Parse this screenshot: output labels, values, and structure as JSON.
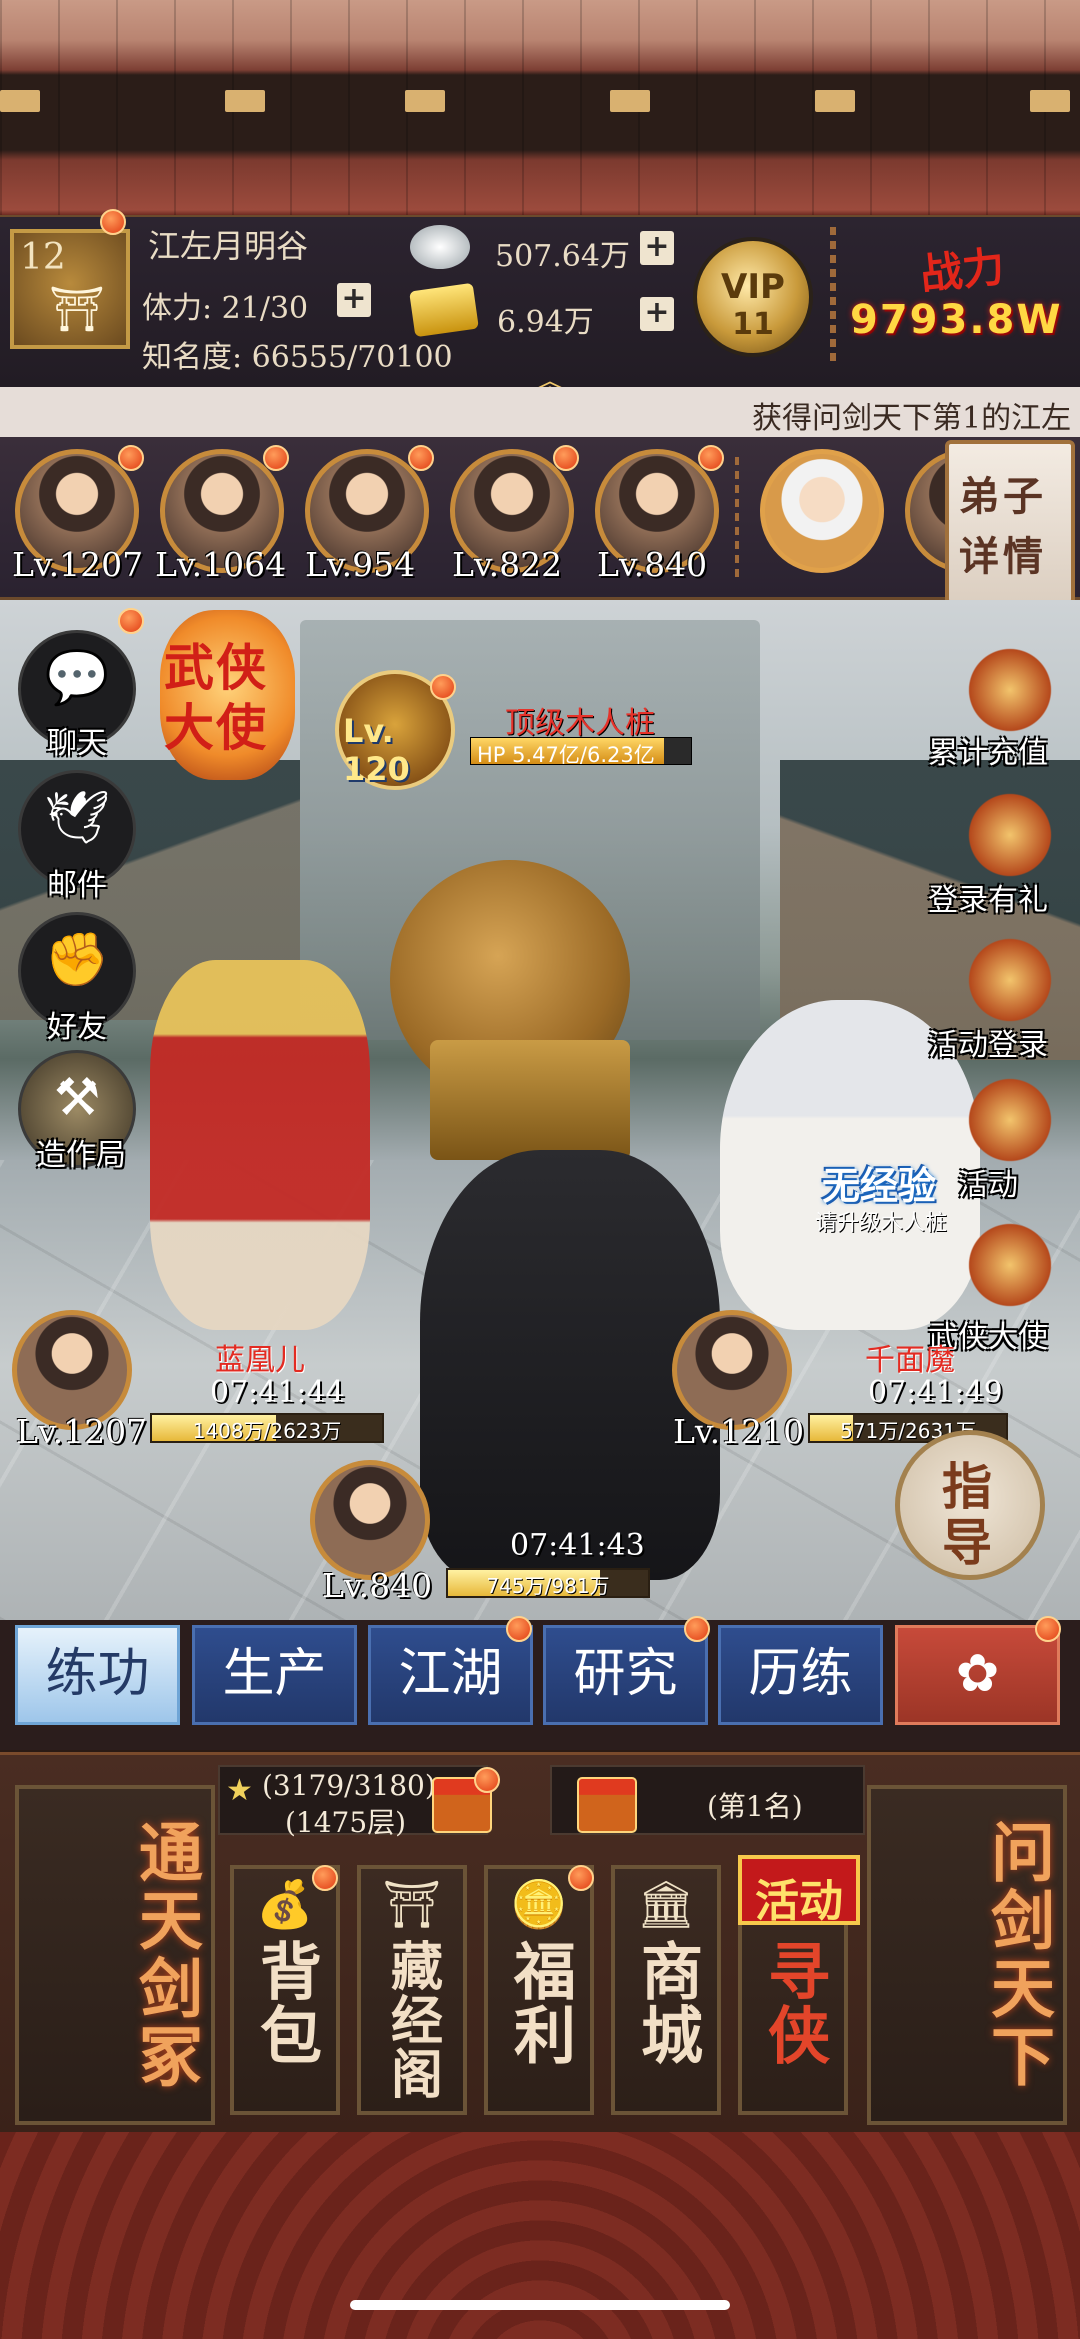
{
  "header": {
    "player_level": "12",
    "player_name": "江左月明谷",
    "stamina_label": "体力:",
    "stamina_value": "21/30",
    "fame_label": "知名度:",
    "fame_value": "66555/70100",
    "silver": "507.64万",
    "gold": "6.94万",
    "vip_label": "VIP",
    "vip_level": "11",
    "power_label": "战力",
    "power_value": "9793.8W",
    "plus_label": "+",
    "expand_icon": "double-chevron-up-icon"
  },
  "marquee": {
    "text": "获得问剑天下第1的江左"
  },
  "disciples": [
    {
      "level": "Lv.1207"
    },
    {
      "level": "Lv.1064"
    },
    {
      "level": "Lv.954"
    },
    {
      "level": "Lv.822"
    },
    {
      "level": "Lv.840"
    },
    {
      "level": ""
    },
    {
      "level": ""
    }
  ],
  "disciple_detail": {
    "line1": "弟子",
    "line2": "详情"
  },
  "left_menu": [
    {
      "label": "聊天",
      "icon": "chat-bubble-icon",
      "glyph": "💬"
    },
    {
      "label": "邮件",
      "icon": "dove-mail-icon",
      "glyph": "🕊"
    },
    {
      "label": "好友",
      "icon": "fist-friend-icon",
      "glyph": "✊"
    },
    {
      "label": "造作局",
      "icon": "workshop-icon",
      "glyph": "⚒"
    }
  ],
  "lantern": {
    "line1": "武侠",
    "line2": "大使"
  },
  "boss": {
    "badge": "Lv. 120",
    "name": "顶级木人桩",
    "hp_text": "HP 5.47亿/6.23亿",
    "hp_fraction": 0.878
  },
  "right_menu": [
    {
      "label": "累计充值",
      "icon": "treasure-icon"
    },
    {
      "label": "登录有礼",
      "icon": "chest-icon"
    },
    {
      "label": "活动登录",
      "icon": "lantern-icon"
    },
    {
      "label": "活动",
      "icon": "festival-icon"
    },
    {
      "label": "武侠大使",
      "icon": "warrior-icon"
    }
  ],
  "no_exp": {
    "title": "无经验",
    "tip": "请升级木人桩"
  },
  "units": {
    "left": {
      "name": "蓝凰儿",
      "timer": "07:41:44",
      "level": "Lv.1207",
      "hp_text": "1408万/2623万",
      "hp_fraction": 0.537
    },
    "right": {
      "name": "千面魔",
      "timer": "07:41:49",
      "level": "Lv.1210",
      "hp_text": "571万/2631万",
      "hp_fraction": 0.217
    },
    "center": {
      "timer": "07:41:43",
      "level": "Lv.840",
      "hp_text": "745万/981万",
      "hp_fraction": 0.759
    }
  },
  "guide": {
    "line1": "指",
    "line2": "导"
  },
  "tabs": [
    {
      "label": "练功"
    },
    {
      "label": "生产"
    },
    {
      "label": "江湖"
    },
    {
      "label": "研究"
    },
    {
      "label": "历练"
    },
    {
      "label": "",
      "icon": "flower-icon"
    }
  ],
  "bottom": {
    "left_card": "通天剑冢",
    "right_card": "问剑天下",
    "tower_progress": "(3179/3180)",
    "tower_floor": "(1475层)",
    "rank_text": "(第1名)",
    "hot_tag": "活动",
    "cards": [
      {
        "label": "背包",
        "icon": "bag-icon",
        "glyph": "💰"
      },
      {
        "label": "藏经阁",
        "icon": "pavilion-icon",
        "glyph": "⛩"
      },
      {
        "label": "福利",
        "icon": "coin-icon",
        "glyph": "🪙"
      },
      {
        "label": "商城",
        "icon": "shop-icon",
        "glyph": "🏛"
      },
      {
        "label": "寻侠",
        "icon": "search-hero-icon",
        "glyph": ""
      }
    ]
  },
  "colors": {
    "accent": "#c78b3b",
    "tab_blue": "#2f4d8e",
    "hot_red": "#c3191b",
    "power_gold": "#ffd843"
  }
}
